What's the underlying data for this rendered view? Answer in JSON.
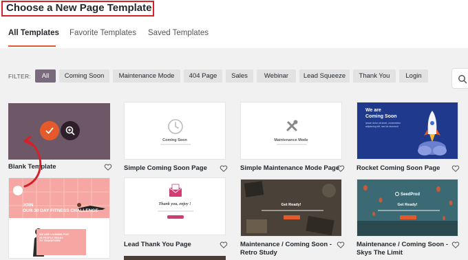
{
  "page": {
    "title": "Choose a New Page Template"
  },
  "tabs": [
    {
      "label": "All Templates",
      "active": true
    },
    {
      "label": "Favorite Templates",
      "active": false
    },
    {
      "label": "Saved Templates",
      "active": false
    }
  ],
  "filter": {
    "label": "FILTER:",
    "chips": [
      {
        "label": "All",
        "active": true
      },
      {
        "label": "Coming Soon",
        "active": false
      },
      {
        "label": "Maintenance Mode",
        "active": false
      },
      {
        "label": "404 Page",
        "active": false
      },
      {
        "label": "Sales",
        "active": false
      },
      {
        "label": "Webinar",
        "active": false
      },
      {
        "label": "Lead Squeeze",
        "active": false
      },
      {
        "label": "Thank You",
        "active": false
      },
      {
        "label": "Login",
        "active": false
      }
    ]
  },
  "templates": [
    {
      "label": "Blank Template"
    },
    {
      "label": "Simple Coming Soon Page",
      "preview_title": "Coming Soon"
    },
    {
      "label": "Simple Maintenance Mode Page",
      "preview_title": "Maintenance Mode"
    },
    {
      "label": "Rocket Coming Soon Page",
      "preview_title": "We are\nComing Soon",
      "preview_sub": "ipsum dolor sit amet, consectetur adipiscing elit, sed do eiusmod"
    },
    {
      "label": "",
      "preview_title": "JOIN\nOUR 30 DAY FITNESS CHALLENGE",
      "preview_sub": "WE ARE LOOKING FOR\n10 PEOPLE READY\nTO TRANSFORM"
    },
    {
      "label": "Lead Thank You Page",
      "preview_title": "Thank you, enjoy !"
    },
    {
      "label": "Maintenance / Coming Soon -\nRetro Study",
      "preview_title": "Get Ready!"
    },
    {
      "label": "Maintenance / Coming Soon -\nSkys The Limit",
      "preview_brand": "SeedProd",
      "preview_title": "Get Ready!"
    }
  ],
  "colors": {
    "accent": "#e45a2a",
    "highlight_border": "#d6212a",
    "active_chip": "#7a6a7e",
    "blank_template_bg": "#6e5868",
    "rocket_bg": "#1f3a8c",
    "fitness_pink": "#f6a7a3"
  }
}
